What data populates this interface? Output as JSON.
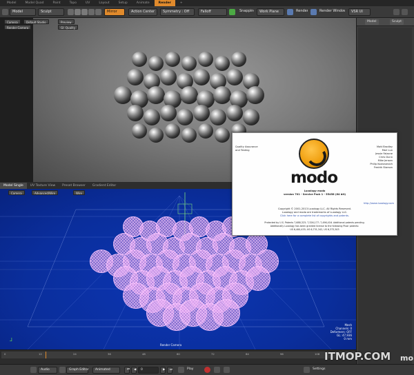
{
  "main_tabs": [
    "Model",
    "Model Quad",
    "Paint",
    "Topo",
    "UV",
    "Layout",
    "Setup",
    "Animate",
    "Render",
    "+"
  ],
  "toolbar": {
    "mode_model": "Model",
    "mode_sculpt": "Sculpt",
    "mirror_label": "Mirror",
    "action_center": "Action Center",
    "symmetry": "Symmetry : Off",
    "falloff": "Falloff",
    "snapping": "Snapping",
    "work_plane": "Work Plane",
    "render": "Render",
    "render_window": "Render Window",
    "vsr": "VSR UI"
  },
  "right_panel": {
    "tab_model": "Model",
    "tab_sculpt": "Sculpt"
  },
  "top_viewport_tags": {
    "camera": "Camera",
    "lighting": "Default Studio",
    "preview": "Preview",
    "render_camera": "Render Camera",
    "gi": "GI: Quality"
  },
  "bottom_viewport": {
    "tabs": [
      "Model Single",
      "UV Texture View",
      "Preset Browser",
      "Gradient Editor"
    ],
    "tag_camera": "Camera",
    "tag_mode": "Advanced/Wire",
    "tag_extra": "Wire",
    "hud_left": "Render Camera",
    "info": [
      "Mesh",
      "Channels: 0",
      "Deformers: OFF",
      "GL: 47,936",
      "0 mm"
    ]
  },
  "timeline": {
    "ticks": [
      "0",
      "12",
      "24",
      "36",
      "48",
      "60",
      "72",
      "84",
      "96",
      "108",
      "120"
    ],
    "playhead_fraction": 0.12
  },
  "bottom_bar": {
    "audio": "Audio",
    "graph_editor": "Graph Editor",
    "animated": "Animated",
    "frame": "0",
    "play": "Play",
    "settings": "Settings"
  },
  "about": {
    "team_left": [
      "Quality Assurance",
      "and Testing"
    ],
    "team_right": [
      "Matt Brodley",
      "Mari Lun",
      "Jessie Falzone",
      "Chris Dunn",
      "Mike Jensen",
      "Philip Kozlonwsich",
      "Fredrik Starson"
    ],
    "product": "Luxology modo",
    "version": "version 701 - Service Pack 1 - 55458 (64 bit)",
    "website": "http://www.luxology.com",
    "copyright": [
      "Copyright © 2001-2013 Luxology LLC. All Rights Reserved.",
      "Luxology and modo are trademarks of Luxology LLC.",
      "Click here for a complete list of copyrights and patents."
    ],
    "patents": [
      "Protected by U.S. Patents 7,688,323; 7,526,177; 7,496,416. Additional patents pending.",
      "Additionally Luxology has been granted license to the following Pixar patents:",
      "US 6,400,435; US 6,731,342, US 6,373,503"
    ],
    "logo_word": "modo"
  },
  "watermark": "ITMOP.COM",
  "badge": "mo"
}
